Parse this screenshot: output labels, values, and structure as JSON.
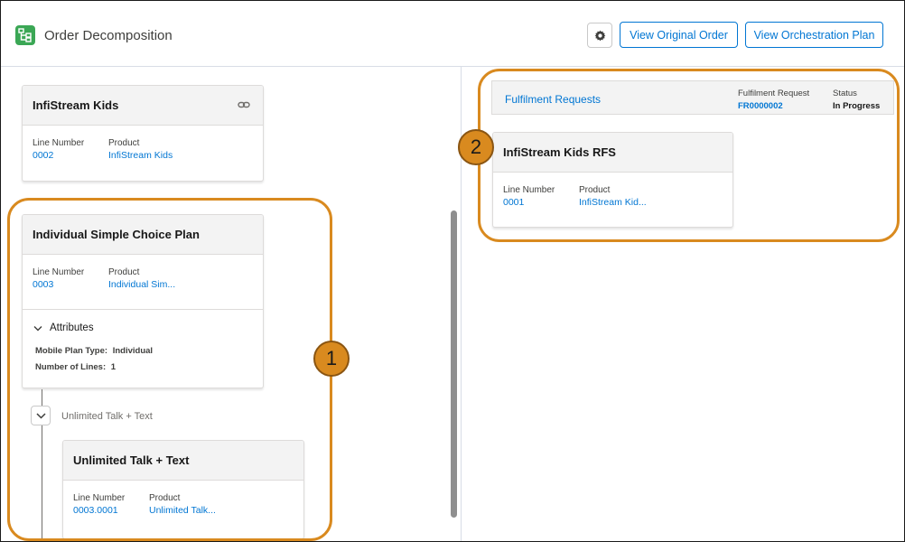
{
  "header": {
    "app_icon": "hierarchy-icon",
    "title": "Order Decomposition",
    "settings_icon": "gear-icon",
    "view_original_label": "View Original Order",
    "view_orchestration_label": "View Orchestration Plan"
  },
  "left": {
    "cards": [
      {
        "title": "InfiStream Kids",
        "icon": "link-icon",
        "line_number_label": "Line Number",
        "line_number": "0002",
        "product_label": "Product",
        "product": "InfiStream Kids"
      },
      {
        "title": "Individual Simple Choice Plan",
        "line_number_label": "Line Number",
        "line_number": "0003",
        "product_label": "Product",
        "product": "Individual Sim...",
        "attributes_label": "Attributes",
        "attributes": [
          {
            "label": "Mobile Plan Type:",
            "value": "Individual"
          },
          {
            "label": "Number of Lines:",
            "value": "1"
          }
        ]
      },
      {
        "title": "Unlimited Talk + Text",
        "line_number_label": "Line Number",
        "line_number": "0003.0001",
        "product_label": "Product",
        "product": "Unlimited Talk..."
      }
    ],
    "tree_group_label": "Unlimited Talk + Text"
  },
  "right": {
    "fulfilment_title": "Fulfilment Requests",
    "fulfilment_request_label": "Fulfilment Request",
    "fulfilment_request_value": "FR0000002",
    "status_label": "Status",
    "status_value": "In Progress",
    "card": {
      "title": "InfiStream Kids RFS",
      "line_number_label": "Line Number",
      "line_number": "0001",
      "product_label": "Product",
      "product": "InfiStream Kid..."
    }
  },
  "annotations": {
    "color": "#d98a1f",
    "badge_1": "1",
    "badge_2": "2"
  }
}
